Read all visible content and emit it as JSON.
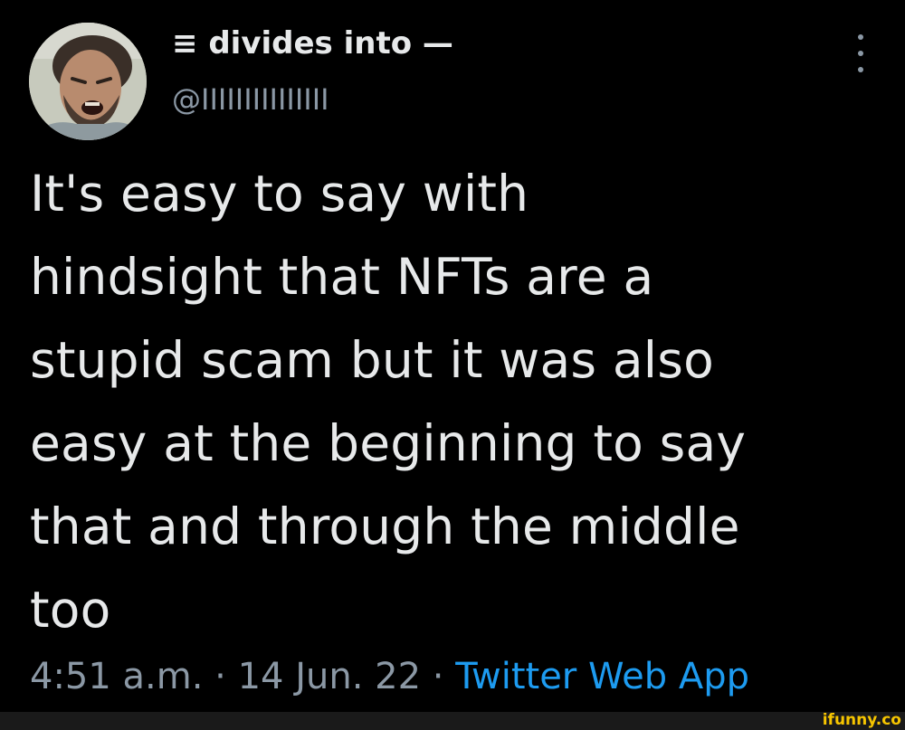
{
  "tweet": {
    "display_name": "≡ divides into —",
    "handle": "@IIIIIIIIIIIIIII",
    "text": "It's easy to say with\nhindsight that NFTs are a\nstupid scam but it was also\neasy at the beginning to say\nthat and through the middle\ntoo",
    "timestamp": "4:51 a.m. · 14 Jun. 22 · ",
    "source": "Twitter Web App"
  },
  "icons": {
    "more": "more-vertical-icon",
    "avatar": "profile-photo"
  },
  "watermark": "ifunny.co",
  "colors": {
    "background": "#000000",
    "text": "#e7e9ea",
    "secondary": "#8b98a5",
    "link": "#1d9bf0",
    "watermark": "#f6c500"
  }
}
